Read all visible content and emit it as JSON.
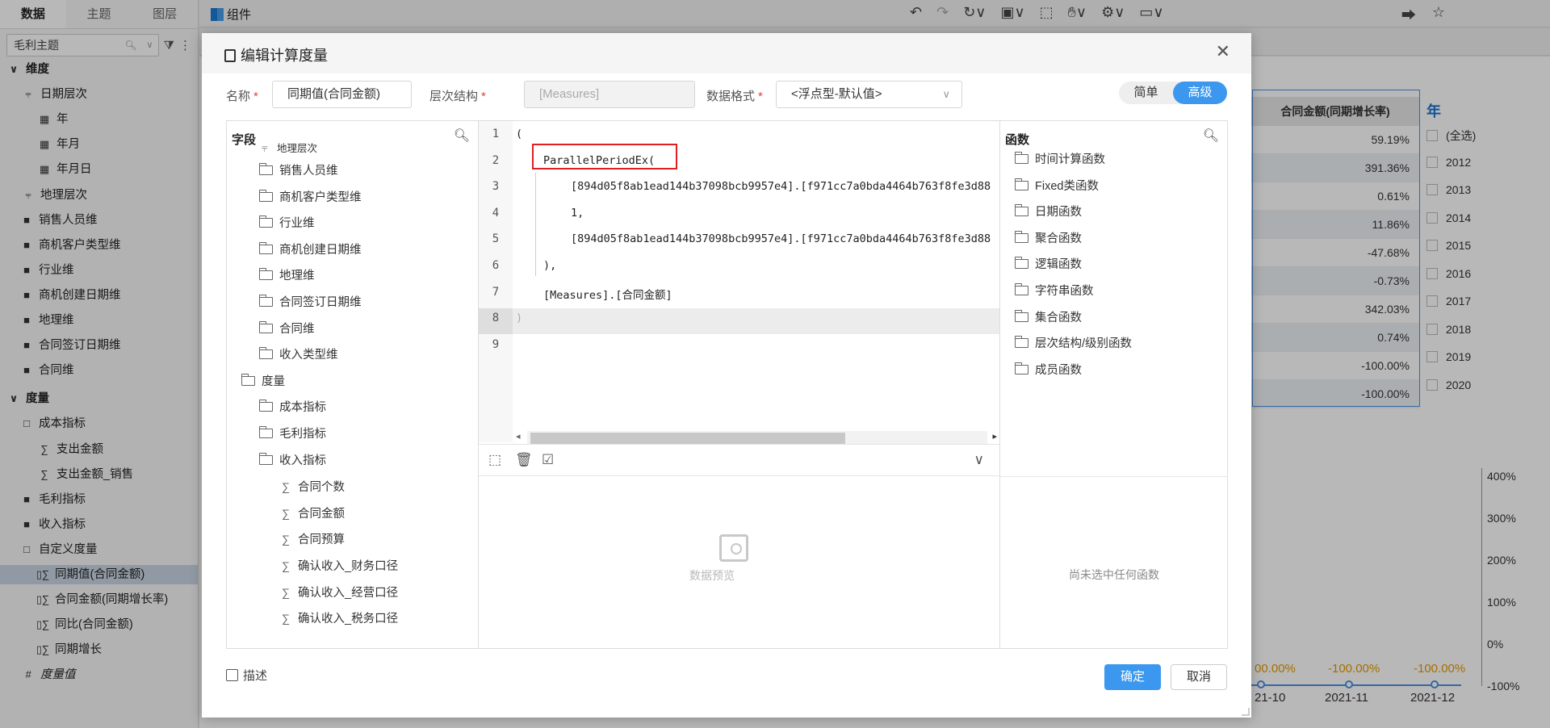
{
  "left_panel": {
    "tabs": [
      "数据",
      "主题",
      "图层"
    ],
    "search_value": "毛利主题",
    "items": [
      {
        "label": "维度",
        "kind": "group",
        "icon": "chevron-down-icon"
      },
      {
        "label": "日期层次",
        "kind": "hier",
        "icon": "hierarchy-icon"
      },
      {
        "label": "年",
        "kind": "level",
        "icon": "calendar-level-icon"
      },
      {
        "label": "年月",
        "kind": "level",
        "icon": "calendar-level-icon"
      },
      {
        "label": "年月日",
        "kind": "level",
        "icon": "calendar-level-icon"
      },
      {
        "label": "地理层次",
        "kind": "hier",
        "icon": "hierarchy-icon"
      },
      {
        "label": "销售人员维",
        "kind": "folder",
        "icon": "folder-icon"
      },
      {
        "label": "商机客户类型维",
        "kind": "folder",
        "icon": "folder-icon"
      },
      {
        "label": "行业维",
        "kind": "folder",
        "icon": "folder-icon"
      },
      {
        "label": "商机创建日期维",
        "kind": "folder",
        "icon": "folder-icon"
      },
      {
        "label": "地理维",
        "kind": "folder",
        "icon": "folder-icon"
      },
      {
        "label": "合同签订日期维",
        "kind": "folder",
        "icon": "folder-icon"
      },
      {
        "label": "合同维",
        "kind": "folder",
        "icon": "folder-icon"
      },
      {
        "label": "度量",
        "kind": "group",
        "icon": "chevron-down-icon"
      },
      {
        "label": "成本指标",
        "kind": "folder-open",
        "icon": "folder-open-icon"
      },
      {
        "label": "支出金额",
        "kind": "measure",
        "icon": "sigma-icon"
      },
      {
        "label": "支出金额_销售",
        "kind": "measure",
        "icon": "sigma-icon"
      },
      {
        "label": "毛利指标",
        "kind": "folder",
        "icon": "folder-icon"
      },
      {
        "label": "收入指标",
        "kind": "folder",
        "icon": "folder-icon"
      },
      {
        "label": "自定义度量",
        "kind": "folder-open",
        "icon": "folder-open-icon"
      },
      {
        "label": "同期值(合同金额)",
        "kind": "calc",
        "icon": "calc-measure-icon",
        "selected": true
      },
      {
        "label": "合同金额(同期增长率)",
        "kind": "calc",
        "icon": "calc-measure-icon"
      },
      {
        "label": "同比(合同金额)",
        "kind": "calc",
        "icon": "calc-measure-icon"
      },
      {
        "label": "同期增长",
        "kind": "calc",
        "icon": "calc-measure-icon"
      },
      {
        "label": "度量值",
        "kind": "measureval",
        "icon": "hash-icon"
      }
    ]
  },
  "topbar": {
    "component_label": "组件"
  },
  "background_table": {
    "header": "合同金额(同期增长率)",
    "rows": [
      "59.19%",
      "391.36%",
      "0.61%",
      "11.86%",
      "-47.68%",
      "-0.73%",
      "342.03%",
      "0.74%",
      "-100.00%",
      "-100.00%"
    ]
  },
  "year_filter": {
    "title": "年",
    "options": [
      "(全选)",
      "2012",
      "2013",
      "2014",
      "2015",
      "2016",
      "2017",
      "2018",
      "2019",
      "2020"
    ]
  },
  "background_chart": {
    "axis_ticks": [
      "400%",
      "300%",
      "200%",
      "100%",
      "0%",
      "-100%"
    ],
    "point_labels": [
      "00.00%",
      "-100.00%",
      "-100.00%"
    ],
    "dates": [
      "21-10",
      "2021-11",
      "2021-12"
    ]
  },
  "dialog": {
    "title": "编辑计算度量",
    "form": {
      "name_label": "名称",
      "name_value": "同期值(合同金额)",
      "hier_label": "层次结构",
      "hier_placeholder": "[Measures]",
      "format_label": "数据格式",
      "format_value": "<浮点型-默认值>",
      "required_mark": "*"
    },
    "mode_toggle": {
      "simple": "简单",
      "advanced": "高级",
      "active": "高级"
    },
    "fields_panel": {
      "title": "字段",
      "items": [
        {
          "label": "地理层次",
          "icon": "hierarchy-icon"
        },
        {
          "label": "销售人员维",
          "icon": "folder-icon"
        },
        {
          "label": "商机客户类型维",
          "icon": "folder-icon"
        },
        {
          "label": "行业维",
          "icon": "folder-icon"
        },
        {
          "label": "商机创建日期维",
          "icon": "folder-icon"
        },
        {
          "label": "地理维",
          "icon": "folder-icon"
        },
        {
          "label": "合同签订日期维",
          "icon": "folder-icon"
        },
        {
          "label": "合同维",
          "icon": "folder-icon"
        },
        {
          "label": "收入类型维",
          "icon": "folder-icon"
        },
        {
          "label": "度量",
          "icon": "folder-open-icon"
        },
        {
          "label": "成本指标",
          "icon": "folder-icon"
        },
        {
          "label": "毛利指标",
          "icon": "folder-icon"
        },
        {
          "label": "收入指标",
          "icon": "folder-open-icon"
        },
        {
          "label": "合同个数",
          "icon": "sigma-icon"
        },
        {
          "label": "合同金额",
          "icon": "sigma-icon"
        },
        {
          "label": "合同预算",
          "icon": "sigma-icon"
        },
        {
          "label": "确认收入_财务口径",
          "icon": "sigma-icon"
        },
        {
          "label": "确认收入_经营口径",
          "icon": "sigma-icon"
        },
        {
          "label": "确认收入_税务口径",
          "icon": "sigma-icon"
        }
      ]
    },
    "editor": {
      "line_numbers": [
        "1",
        "2",
        "3",
        "4",
        "5",
        "6",
        "7",
        "8",
        "9"
      ],
      "lines": [
        "(",
        "ParallelPeriodEx(",
        "[894d05f8ab1ead144b37098bcb9957e4].[f971cc7a0bda4464b763f8fe3d88",
        "1,",
        "[894d05f8ab1ead144b37098bcb9957e4].[f971cc7a0bda4464b763f8fe3d88",
        "),",
        "[Measures].[合同金额]",
        ")",
        ""
      ],
      "preview_label": "数据预览"
    },
    "functions_panel": {
      "title": "函数",
      "items": [
        "时间计算函数",
        "Fixed类函数",
        "日期函数",
        "聚合函数",
        "逻辑函数",
        "字符串函数",
        "集合函数",
        "层次结构/级别函数",
        "成员函数"
      ],
      "empty_text": "尚未选中任何函数"
    },
    "footer": {
      "describe_label": "描述",
      "ok_label": "确定",
      "cancel_label": "取消"
    }
  }
}
